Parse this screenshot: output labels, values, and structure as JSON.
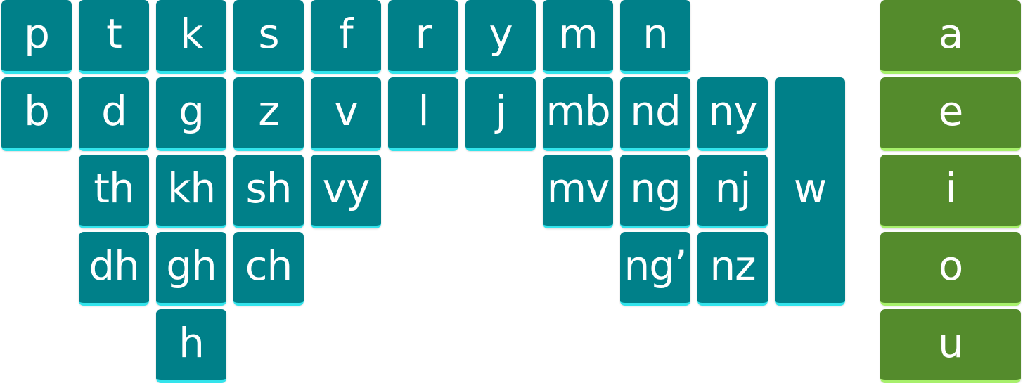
{
  "consonants": {
    "row1": [
      "p",
      "t",
      "k",
      "s",
      "f",
      "r",
      "y",
      "m",
      "n"
    ],
    "row2": [
      "b",
      "d",
      "g",
      "z",
      "v",
      "l",
      "j",
      "mb",
      "nd",
      "ny"
    ],
    "row3": [
      "th",
      "kh",
      "sh",
      "vy",
      "mv",
      "ng",
      "nj"
    ],
    "row4": [
      "dh",
      "gh",
      "ch",
      "ng’",
      "nz"
    ],
    "row5": [
      "h"
    ],
    "tall": "w"
  },
  "vowels": [
    "a",
    "e",
    "i",
    "o",
    "u"
  ],
  "colors": {
    "consonant_fill": "#008089",
    "consonant_edge": "#33e4ec",
    "vowel_fill": "#548b2c",
    "vowel_edge": "#a7f06b"
  }
}
